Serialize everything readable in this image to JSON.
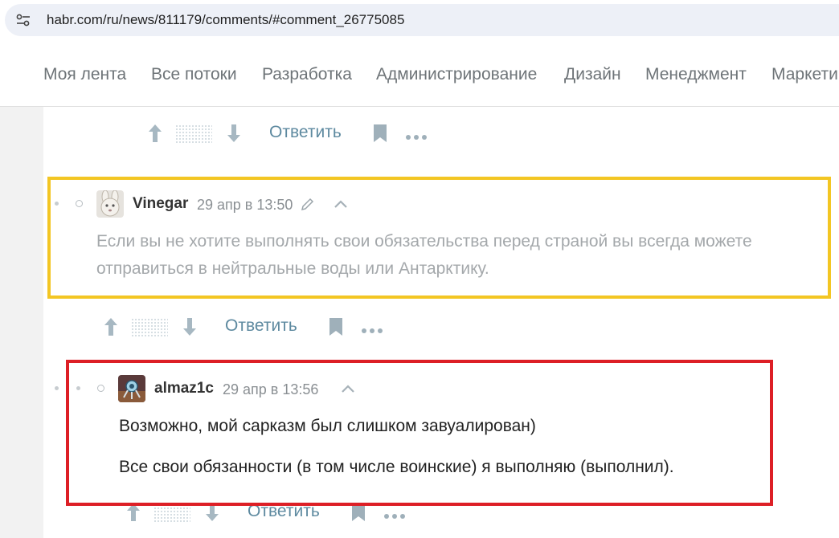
{
  "browser": {
    "url": "habr.com/ru/news/811179/comments/#comment_26775085"
  },
  "nav": {
    "items": [
      "Моя лента",
      "Все потоки",
      "Разработка",
      "Администрирование",
      "Дизайн",
      "Менеджмент",
      "Маркети"
    ]
  },
  "actions": {
    "reply_label": "Ответить"
  },
  "comments": [
    {
      "username": "Vinegar",
      "time": "29 апр в 13:50",
      "paragraphs": [
        "Если вы не хотите выполнять свои обязательства перед страной вы всегда можете отправиться в нейтральные воды или Антарктику."
      ]
    },
    {
      "username": "almaz1c",
      "time": "29 апр в 13:56",
      "paragraphs": [
        "Возможно, мой сарказм был слишком завуалирован)",
        "Все свои обязанности (в том числе воинские) я выполняю (выполнил)."
      ]
    }
  ],
  "colors": {
    "highlight_yellow": "#f3c623",
    "highlight_red": "#dd1f26",
    "link": "#5e8aa0"
  }
}
